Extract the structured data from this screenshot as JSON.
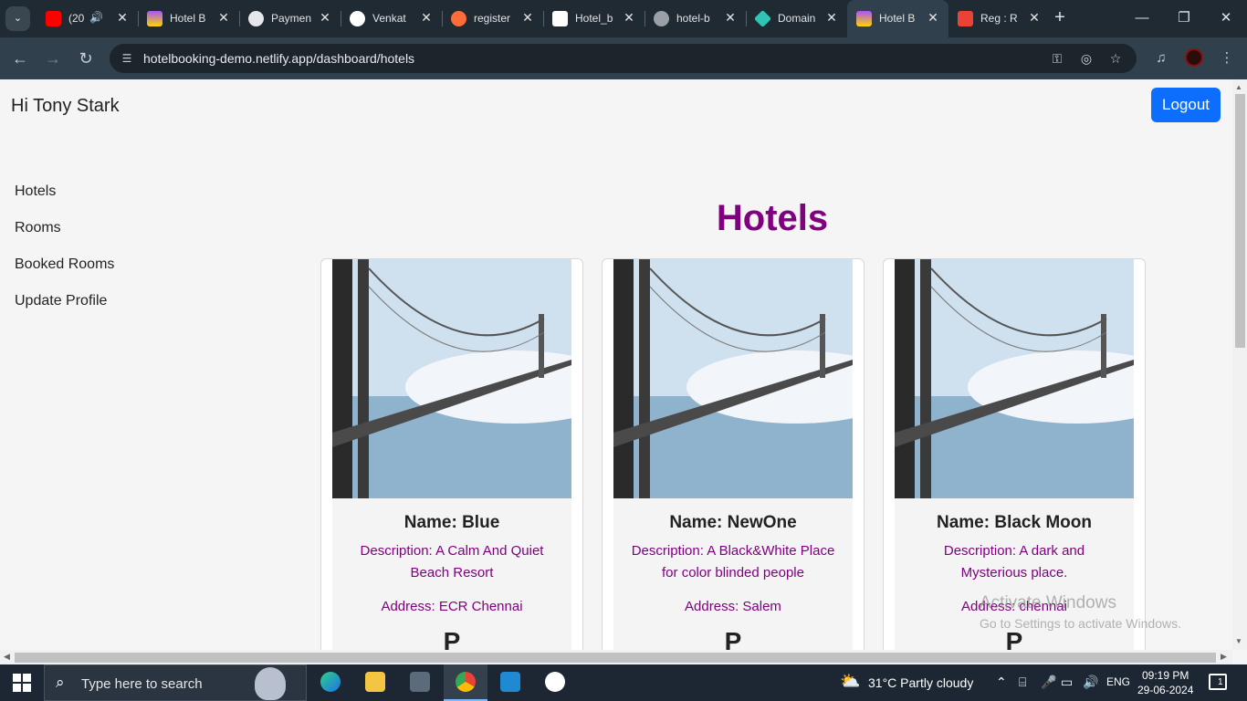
{
  "browser": {
    "tabs": [
      {
        "title": "(20",
        "icon": "youtube-icon",
        "color": "#ff0000"
      },
      {
        "title": "Hotel B",
        "icon": "vite-icon",
        "color": "#a855f7"
      },
      {
        "title": "Paymen",
        "icon": "openai-icon",
        "color": "#e5e7eb"
      },
      {
        "title": "Venkat",
        "icon": "github-icon",
        "color": "#ffffff"
      },
      {
        "title": "register",
        "icon": "postman-icon",
        "color": "#ff6c37"
      },
      {
        "title": "Hotel_b",
        "icon": "render-icon",
        "color": "#ffffff"
      },
      {
        "title": "hotel-b",
        "icon": "globe-icon",
        "color": "#9aa0a6"
      },
      {
        "title": "Domain",
        "icon": "netlify-icon",
        "color": "#32c3b5"
      },
      {
        "title": "Hotel B",
        "icon": "vite-icon",
        "color": "#a855f7"
      },
      {
        "title": "Reg : R",
        "icon": "gmail-icon",
        "color": "#ea4335"
      }
    ],
    "url": "hotelbooking-demo.netlify.app/dashboard/hotels"
  },
  "page": {
    "greeting": "Hi Tony Stark",
    "logout_label": "Logout",
    "nav": [
      "Hotels",
      "Rooms",
      "Booked Rooms",
      "Update Profile"
    ],
    "heading": "Hotels",
    "heading_color": "#800080",
    "accent_button_color": "#0d6efd",
    "hotels": [
      {
        "name": "Name: Blue",
        "description": "Description: A Calm And Quiet Beach Resort",
        "address": "Address: ECR Chennai",
        "more": "P"
      },
      {
        "name": "Name: NewOne",
        "description": "Description: A Black&White Place for color blinded people",
        "address": "Address: Salem",
        "more": "P"
      },
      {
        "name": "Name: Black Moon",
        "description": "Description: A dark and Mysterious place.",
        "address": "Address: chennai",
        "more": "P"
      }
    ]
  },
  "watermark": {
    "line1": "Activate Windows",
    "line2": "Go to Settings to activate Windows."
  },
  "taskbar": {
    "search_placeholder": "Type here to search",
    "weather": "31°C  Partly cloudy",
    "language": "ENG",
    "time": "09:19 PM",
    "date": "29-06-2024",
    "notifications": "1"
  }
}
